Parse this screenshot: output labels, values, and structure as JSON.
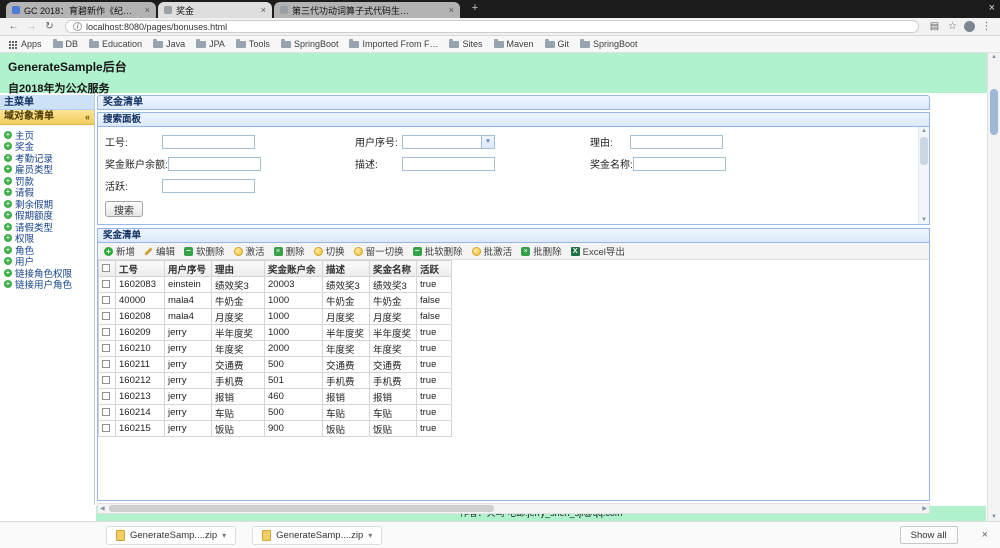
{
  "browser": {
    "tabs": [
      {
        "title": "GC 2018：育碧新作《纪元…",
        "active": false
      },
      {
        "title": "奖金",
        "active": true
      },
      {
        "title": "第三代功动词算子式代码生…",
        "active": false
      }
    ],
    "new_tab_label": "+",
    "window_close_label": "×",
    "nav": {
      "back": "←",
      "forward": "→",
      "reload": "↻",
      "reading_list": "▤",
      "bookmark_star": "☆",
      "menu": "⋮",
      "info": "i"
    },
    "url": "localhost:8080/pages/bonuses.html",
    "bookmarks": [
      "Apps",
      "DB",
      "Education",
      "Java",
      "JPA",
      "Tools",
      "SpringBoot",
      "Imported From F…",
      "Sites",
      "Maven",
      "Git",
      "SpringBoot"
    ]
  },
  "page": {
    "header": {
      "title": "GenerateSample后台",
      "subtitle": "自2018年为公众服务"
    },
    "sidebar": {
      "panel_title": "主菜单",
      "accordion_title": "域对象清单",
      "collapse_icon": "«",
      "items": [
        "主页",
        "奖金",
        "考勤记录",
        "雇员类型",
        "罚款",
        "请假",
        "剩余假期",
        "假期额度",
        "请假类型",
        "权限",
        "角色",
        "用户",
        "链接角色权限",
        "链接用户角色"
      ]
    },
    "main": {
      "panel_title": "奖金清单",
      "search": {
        "title": "搜索面板",
        "rows": [
          [
            {
              "label": "工号:",
              "type": "text"
            },
            {
              "label": "用户序号:",
              "type": "select"
            },
            {
              "label": "理由:",
              "type": "text"
            }
          ],
          [
            {
              "label": "奖金账户余额:",
              "type": "text"
            },
            {
              "label": "描述:",
              "type": "text"
            },
            {
              "label": "奖金名称:",
              "type": "text"
            }
          ],
          [
            {
              "label": "活跃:",
              "type": "text"
            }
          ]
        ],
        "button_label": "搜索"
      },
      "grid": {
        "title": "奖金清单",
        "toolbar": [
          {
            "label": "新增",
            "icon": "add-icon"
          },
          {
            "label": "编辑",
            "icon": "edit-icon"
          },
          {
            "label": "软删除",
            "icon": "soft-delete-icon"
          },
          {
            "label": "激活",
            "icon": "activate-icon"
          },
          {
            "label": "删除",
            "icon": "delete-icon"
          },
          {
            "label": "切换",
            "icon": "toggle-icon"
          },
          {
            "label": "留一切换",
            "icon": "toggle-one-icon"
          },
          {
            "label": "批软删除",
            "icon": "batch-soft-delete-icon"
          },
          {
            "label": "批激活",
            "icon": "batch-activate-icon"
          },
          {
            "label": "批删除",
            "icon": "batch-delete-icon"
          },
          {
            "label": "Excel导出",
            "icon": "excel-export-icon"
          }
        ],
        "columns": [
          "工号",
          "用户序号",
          "理由",
          "奖金账户余",
          "描述",
          "奖金名称",
          "活跃"
        ],
        "rows": [
          [
            "1602083",
            "einstein",
            "绩效奖3",
            "20003",
            "绩效奖3",
            "绩效奖3",
            "true"
          ],
          [
            "40000",
            "mala4",
            "牛奶金",
            "1000",
            "牛奶金",
            "牛奶金",
            "false"
          ],
          [
            "160208",
            "mala4",
            "月度奖",
            "1000",
            "月度奖",
            "月度奖",
            "false"
          ],
          [
            "160209",
            "jerry",
            "半年度奖",
            "1000",
            "半年度奖",
            "半年度奖",
            "true"
          ],
          [
            "160210",
            "jerry",
            "年度奖",
            "2000",
            "年度奖",
            "年度奖",
            "true"
          ],
          [
            "160211",
            "jerry",
            "交通费",
            "500",
            "交通费",
            "交通费",
            "true"
          ],
          [
            "160212",
            "jerry",
            "手机费",
            "501",
            "手机费",
            "手机费",
            "true"
          ],
          [
            "160213",
            "jerry",
            "报销",
            "460",
            "报销",
            "报销",
            "true"
          ],
          [
            "160214",
            "jerry",
            "车贴",
            "500",
            "车贴",
            "车贴",
            "true"
          ],
          [
            "160215",
            "jerry",
            "饭贴",
            "900",
            "饭贴",
            "饭贴",
            "true"
          ]
        ]
      }
    },
    "footer": {
      "text": "作者：火鸟 电邮:jerry_shen_sjf@qq.com"
    }
  },
  "downloads": {
    "items": [
      "GenerateSamp....zip",
      "GenerateSamp....zip"
    ],
    "show_all_label": "Show all",
    "close_label": "×"
  },
  "colors": {
    "header_green": "#b0f2cd",
    "panel_border": "#95b8e7",
    "accordion_yellow": "#f2cd5d",
    "link_blue": "#15428b"
  }
}
